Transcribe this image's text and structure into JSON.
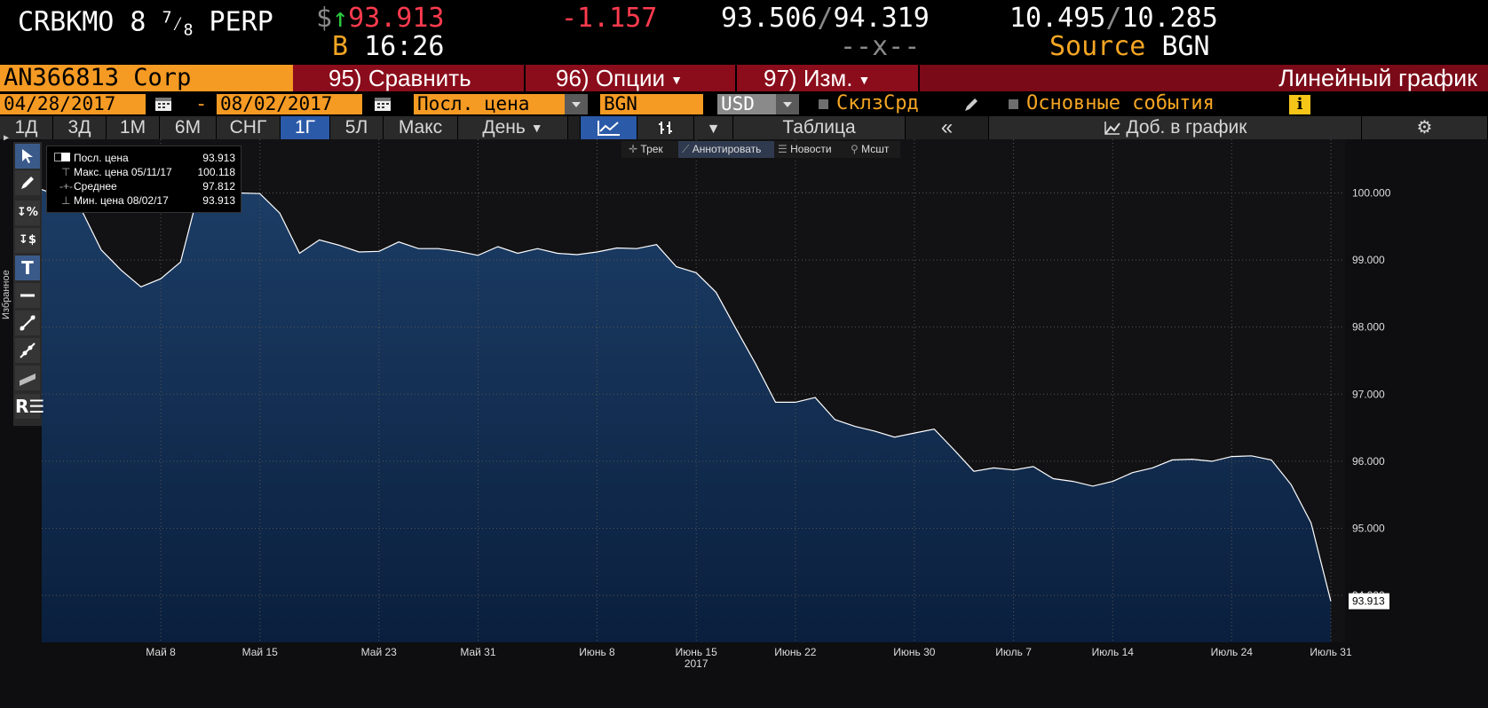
{
  "quote": {
    "ticker": "CRBKMO 8",
    "fraction_num": "7",
    "fraction_den": "8",
    "suffix": "PERP",
    "currency_symbol": "$",
    "last_price": "93.913",
    "change": "-1.157",
    "bid": "93.506",
    "ask": "94.319",
    "yield_bid": "10.495",
    "yield_ask": "10.285",
    "time_label": "B",
    "time": "16:26",
    "spread_placeholder": "--x--",
    "source_label": "Source",
    "source": "BGN",
    "separator": "/"
  },
  "bar1": {
    "security": "AN366813 Corp",
    "compare_num": "95)",
    "compare_label": "Сравнить",
    "options_num": "96)",
    "options_label": "Опции",
    "edit_num": "97)",
    "edit_label": "Изм.",
    "chart_type": "Линейный график"
  },
  "bar2": {
    "start_date": "04/28/2017",
    "dash": "-",
    "end_date": "08/02/2017",
    "price_field": "Посл. цена",
    "source": "BGN",
    "currency": "USD",
    "spread_option": "СклзСрд",
    "events_option": "Основные события",
    "info": "i"
  },
  "tabs": {
    "periods": [
      "1Д",
      "3Д",
      "1М",
      "6М",
      "СНГ",
      "1Г",
      "5Л",
      "Макс"
    ],
    "selected": "1Г",
    "interval": "День",
    "table": "Таблица",
    "collapse": "«",
    "add_to_chart": "Доб. в график"
  },
  "annotation_bar": {
    "track": "Трек",
    "annotate": "Аннотировать",
    "news": "Новости",
    "zoom": "Мсшт"
  },
  "legend": {
    "rows": [
      {
        "label": "Посл. цена",
        "value": "93.913"
      },
      {
        "label": "Макс. цена 05/11/17",
        "value": "100.118"
      },
      {
        "label": "Среднее",
        "value": "97.812"
      },
      {
        "label": "Мин. цена 08/02/17",
        "value": "93.913"
      }
    ]
  },
  "toolbar": {
    "favorites_label": "Избранное"
  },
  "chart_data": {
    "type": "area",
    "series": [
      {
        "name": "Посл. цена",
        "values": [
          100.05,
          99.95,
          99.75,
          99.15,
          98.85,
          98.6,
          98.72,
          98.97,
          100.118,
          99.98,
          100.0,
          99.99,
          99.7,
          99.1,
          99.3,
          99.22,
          99.12,
          99.13,
          99.27,
          99.17,
          99.17,
          99.13,
          99.07,
          99.2,
          99.1,
          99.17,
          99.1,
          99.08,
          99.12,
          99.18,
          99.17,
          99.23,
          98.9,
          98.81,
          98.52,
          97.98,
          97.45,
          96.88,
          96.88,
          96.95,
          96.62,
          96.52,
          96.45,
          96.36,
          96.42,
          96.48,
          96.17,
          95.85,
          95.9,
          95.87,
          95.92,
          95.74,
          95.7,
          95.63,
          95.7,
          95.83,
          95.9,
          96.02,
          96.03,
          96.0,
          96.07,
          96.08,
          96.02,
          95.65,
          95.08,
          93.913
        ]
      }
    ],
    "x_tick_labels": [
      "Май 8",
      "Май 15",
      "Май 23",
      "Май 31",
      "Июнь 8",
      "Июнь 15",
      "Июнь 22",
      "Июнь 30",
      "Июль 7",
      "Июль 14",
      "Июль 24",
      "Июль 31"
    ],
    "x_tick_index": [
      6,
      11,
      17,
      22,
      28,
      33,
      38,
      44,
      49,
      54,
      60,
      65
    ],
    "year_label": "2017",
    "y_tick_labels": [
      "100.000",
      "99.000",
      "98.000",
      "97.000",
      "96.000",
      "95.000"
    ],
    "y_ticks": [
      100,
      99,
      98,
      97,
      96,
      95
    ],
    "ylim": [
      93.3,
      100.8
    ],
    "last_value_label": "93.913",
    "partial_tick_label": "94.000",
    "colors": {
      "fill": "#0f2a4a",
      "line": "#ffffff",
      "grid": "#555555"
    }
  }
}
